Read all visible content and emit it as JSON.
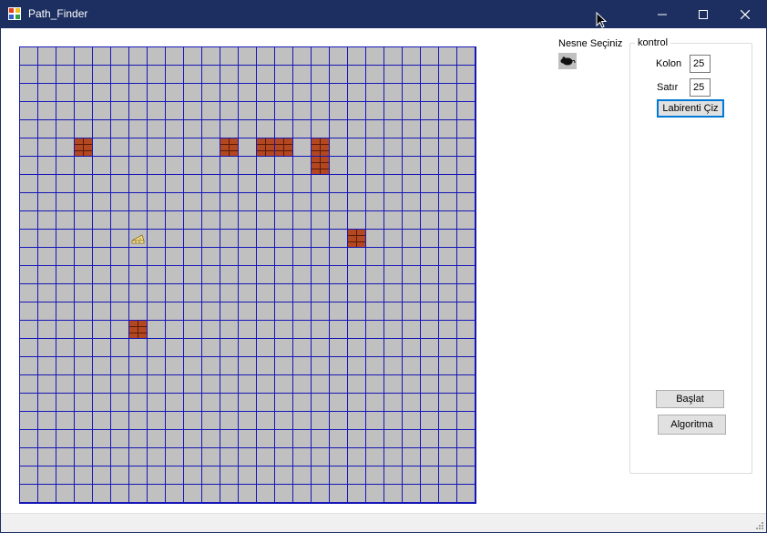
{
  "window": {
    "title": "Path_Finder"
  },
  "grid": {
    "columns": 25,
    "rows": 25,
    "bricks": [
      [
        3,
        5
      ],
      [
        11,
        5
      ],
      [
        13,
        5
      ],
      [
        14,
        5
      ],
      [
        16,
        5
      ],
      [
        16,
        6
      ],
      [
        18,
        10
      ],
      [
        6,
        15
      ]
    ],
    "cheese": [
      6,
      10
    ],
    "colors": {
      "cell": "#c0c0c0",
      "line": "#1616b8",
      "brick": "#b34720"
    }
  },
  "object_picker": {
    "label": "Nesne Seçiniz",
    "icon": "mouse-icon"
  },
  "control": {
    "legend": "kontrol",
    "kolon_label": "Kolon",
    "kolon_value": "25",
    "satir_label": "Satır",
    "satir_value": "25",
    "draw_button": "Labirenti Çiz",
    "start_button": "Başlat",
    "algorithm_button": "Algoritma"
  }
}
